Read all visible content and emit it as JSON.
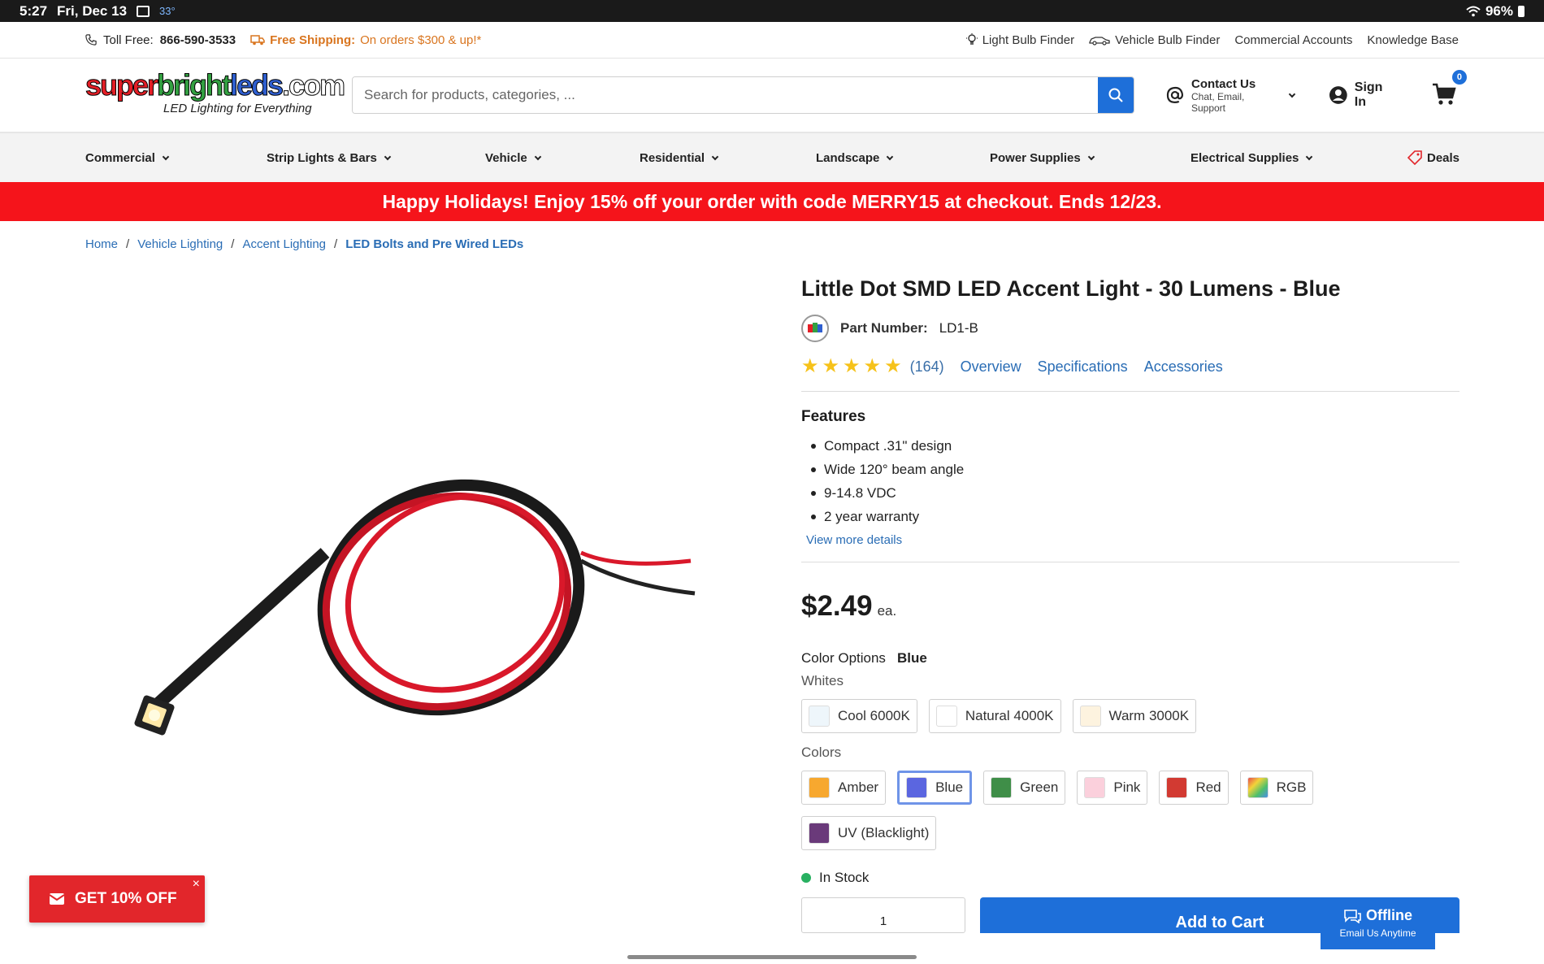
{
  "status": {
    "time": "5:27",
    "date": "Fri, Dec 13",
    "temp": "33°",
    "battery": "96%"
  },
  "utility": {
    "toll_label": "Toll Free:",
    "toll_number": "866-590-3533",
    "ship_label": "Free Shipping:",
    "ship_text": "On orders $300 & up!*",
    "links": [
      "Light Bulb Finder",
      "Vehicle Bulb Finder",
      "Commercial Accounts",
      "Knowledge Base"
    ]
  },
  "header": {
    "logo_part1": "super",
    "logo_part2": "bright",
    "logo_part3": "leds",
    "logo_part4": ".com",
    "tagline": "LED Lighting for Everything",
    "search_placeholder": "Search for products, categories, ...",
    "contact_title": "Contact Us",
    "contact_sub": "Chat, Email, Support",
    "signin": "Sign In",
    "cart_count": "0"
  },
  "nav": {
    "items": [
      "Commercial",
      "Strip Lights & Bars",
      "Vehicle",
      "Residential",
      "Landscape",
      "Power Supplies",
      "Electrical Supplies"
    ],
    "deals": "Deals"
  },
  "promo": "Happy Holidays! Enjoy 15% off your order with code MERRY15 at checkout. Ends 12/23.",
  "breadcrumb": [
    "Home",
    "Vehicle Lighting",
    "Accent Lighting",
    "LED Bolts and Pre Wired LEDs"
  ],
  "product": {
    "title": "Little Dot SMD LED Accent Light - 30 Lumens - Blue",
    "part_label": "Part Number:",
    "part_number": "LD1-B",
    "rating": 5,
    "review_count": "(164)",
    "tabs": [
      "Overview",
      "Specifications",
      "Accessories"
    ],
    "features_title": "Features",
    "features": [
      "Compact .31\" design",
      "Wide 120° beam angle",
      "9-14.8 VDC",
      "2 year warranty"
    ],
    "view_more": "View more details",
    "price": "$2.49",
    "price_unit": "ea.",
    "color_label": "Color Options",
    "color_value": "Blue",
    "whites_label": "Whites",
    "whites": [
      {
        "label": "Cool 6000K",
        "color": "#eef6fb"
      },
      {
        "label": "Natural 4000K",
        "color": "#ffffff"
      },
      {
        "label": "Warm 3000K",
        "color": "#fdf3df"
      }
    ],
    "colors_label": "Colors",
    "colors": [
      {
        "label": "Amber",
        "color": "#f7a82f"
      },
      {
        "label": "Blue",
        "color": "#5b66e0"
      },
      {
        "label": "Green",
        "color": "#3f8e48"
      },
      {
        "label": "Pink",
        "color": "#fbd0dc"
      },
      {
        "label": "Red",
        "color": "#d23a32"
      },
      {
        "label": "RGB",
        "color": "#8fc96a"
      },
      {
        "label": "UV (Blacklight)",
        "color": "#6a3a7a"
      }
    ],
    "selected_color": "Blue",
    "stock": "In Stock",
    "qty": "1",
    "add_to_cart": "Add to Cart"
  },
  "offer": {
    "label": "GET 10% OFF",
    "close": "×"
  },
  "chat": {
    "title": "Offline",
    "sub": "Email Us Anytime"
  },
  "colors": {
    "accent": "#1e6fd9",
    "promo_red": "#f5141b",
    "link": "#2a6db5",
    "star": "#f6c21a"
  }
}
